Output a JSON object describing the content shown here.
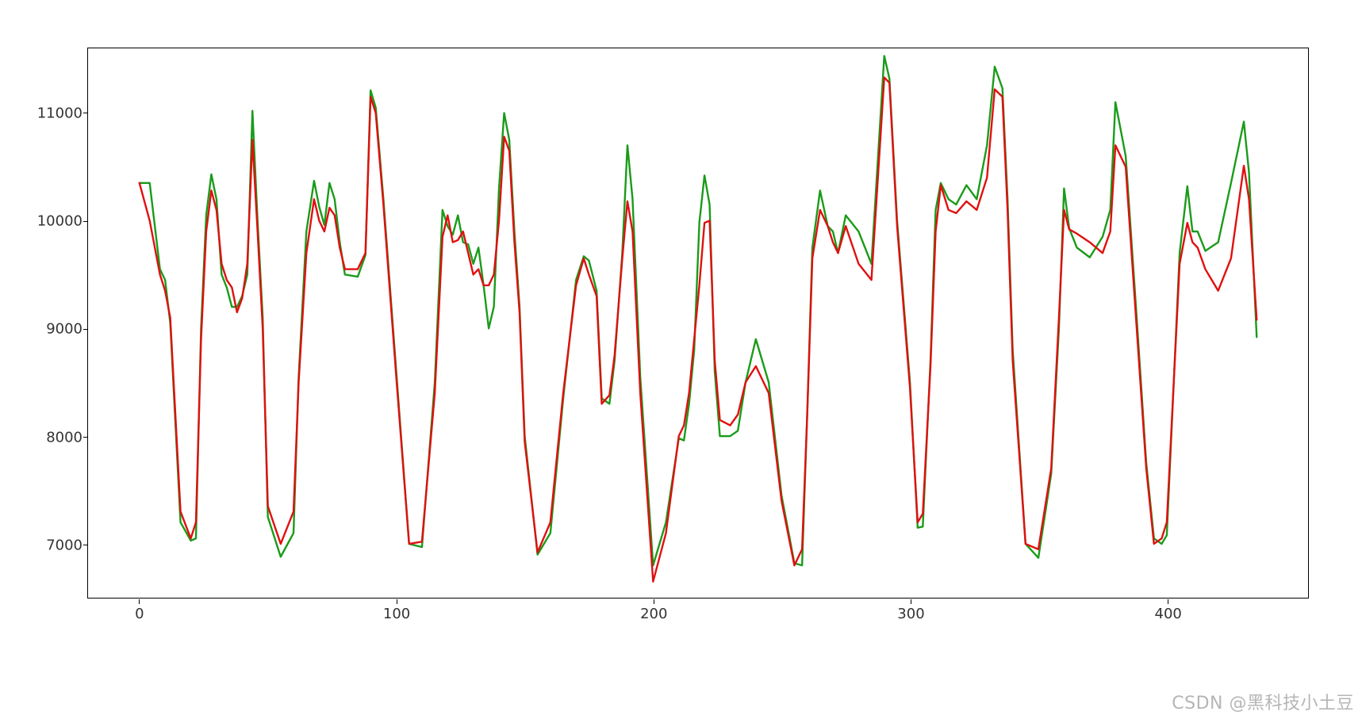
{
  "watermark": "CSDN @黑科技小土豆",
  "chart_data": {
    "type": "line",
    "title": "",
    "xlabel": "",
    "ylabel": "",
    "xlim": [
      -20,
      455
    ],
    "ylim": [
      6500,
      11600
    ],
    "xticks": [
      0,
      100,
      200,
      300,
      400
    ],
    "yticks": [
      7000,
      8000,
      9000,
      10000,
      11000
    ],
    "x": [
      0,
      4,
      8,
      10,
      12,
      16,
      20,
      22,
      24,
      26,
      28,
      30,
      32,
      34,
      36,
      38,
      40,
      42,
      44,
      46,
      48,
      50,
      55,
      60,
      62,
      65,
      68,
      70,
      72,
      74,
      76,
      78,
      80,
      85,
      88,
      90,
      92,
      95,
      100,
      105,
      110,
      115,
      118,
      120,
      122,
      124,
      126,
      128,
      130,
      132,
      134,
      136,
      138,
      140,
      142,
      144,
      146,
      148,
      150,
      155,
      160,
      165,
      170,
      173,
      175,
      178,
      180,
      183,
      185,
      188,
      190,
      192,
      195,
      200,
      205,
      210,
      212,
      214,
      216,
      218,
      220,
      222,
      224,
      226,
      230,
      233,
      236,
      240,
      245,
      250,
      255,
      258,
      260,
      262,
      265,
      268,
      270,
      272,
      275,
      280,
      285,
      290,
      292,
      295,
      300,
      303,
      305,
      308,
      310,
      312,
      315,
      318,
      322,
      326,
      330,
      333,
      336,
      338,
      340,
      345,
      350,
      355,
      358,
      360,
      362,
      365,
      370,
      375,
      378,
      380,
      384,
      388,
      392,
      395,
      398,
      400,
      405,
      408,
      410,
      412,
      415,
      420,
      425,
      430,
      432,
      435
    ],
    "series": [
      {
        "name": "series-green",
        "color": "#1a9b1a",
        "values": [
          10350,
          10350,
          9550,
          9450,
          9050,
          7200,
          7030,
          7050,
          9000,
          10050,
          10430,
          10200,
          9500,
          9380,
          9200,
          9200,
          9300,
          9500,
          11020,
          10000,
          9100,
          7250,
          6880,
          7100,
          8550,
          9900,
          10370,
          10130,
          9960,
          10350,
          10200,
          9800,
          9500,
          9480,
          9680,
          11210,
          11050,
          10200,
          8600,
          7000,
          6970,
          8500,
          10100,
          9950,
          9870,
          10050,
          9800,
          9780,
          9600,
          9750,
          9400,
          9000,
          9200,
          10300,
          11000,
          10750,
          9900,
          9200,
          8000,
          6900,
          7100,
          8350,
          9450,
          9670,
          9630,
          9350,
          8350,
          8300,
          8700,
          9700,
          10700,
          10200,
          8550,
          6800,
          7200,
          7980,
          7960,
          8300,
          8800,
          9980,
          10420,
          10150,
          8600,
          8000,
          8000,
          8050,
          8500,
          8900,
          8500,
          7450,
          6820,
          6800,
          8200,
          9750,
          10280,
          9950,
          9900,
          9700,
          10050,
          9900,
          9600,
          11530,
          11320,
          10000,
          8500,
          7150,
          7160,
          8700,
          10100,
          10350,
          10200,
          10150,
          10330,
          10200,
          10700,
          11430,
          11230,
          10200,
          8800,
          7000,
          6870,
          7650,
          9000,
          10300,
          9930,
          9750,
          9660,
          9850,
          10100,
          11100,
          10600,
          9200,
          7750,
          7050,
          7000,
          7080,
          9700,
          10320,
          9900,
          9900,
          9720,
          9800,
          10350,
          10920,
          10450,
          8920
        ]
      },
      {
        "name": "series-red",
        "color": "#e01010",
        "values": [
          10350,
          10000,
          9500,
          9350,
          9100,
          7300,
          7050,
          7200,
          8900,
          9900,
          10280,
          10100,
          9600,
          9450,
          9380,
          9150,
          9280,
          9600,
          10750,
          9900,
          9000,
          7350,
          7000,
          7300,
          8500,
          9700,
          10200,
          10000,
          9900,
          10120,
          10050,
          9750,
          9550,
          9550,
          9700,
          11150,
          11000,
          10150,
          8550,
          7000,
          7020,
          8400,
          9850,
          10050,
          9800,
          9820,
          9900,
          9700,
          9500,
          9550,
          9400,
          9400,
          9500,
          10000,
          10780,
          10650,
          9800,
          9150,
          7950,
          6920,
          7200,
          8400,
          9400,
          9650,
          9500,
          9300,
          8300,
          8380,
          8750,
          9650,
          10180,
          9900,
          8400,
          6650,
          7100,
          8000,
          8100,
          8400,
          8900,
          9400,
          9980,
          10000,
          8700,
          8150,
          8100,
          8200,
          8500,
          8650,
          8400,
          7400,
          6800,
          6950,
          8200,
          9650,
          10100,
          9950,
          9800,
          9700,
          9950,
          9600,
          9450,
          11330,
          11280,
          9950,
          8450,
          7200,
          7280,
          8650,
          9900,
          10330,
          10100,
          10070,
          10180,
          10100,
          10400,
          11220,
          11150,
          10100,
          8700,
          7000,
          6950,
          7700,
          9100,
          10100,
          9920,
          9880,
          9800,
          9700,
          9900,
          10700,
          10500,
          9100,
          7700,
          7000,
          7050,
          7200,
          9600,
          9980,
          9800,
          9750,
          9550,
          9350,
          9650,
          10510,
          10200,
          9080
        ]
      }
    ]
  }
}
